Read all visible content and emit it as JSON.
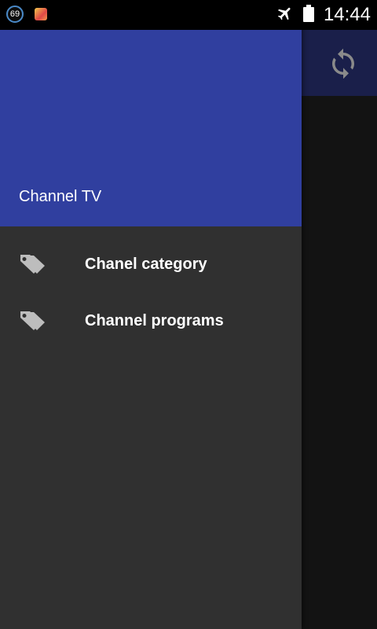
{
  "status_bar": {
    "notification_count": "69",
    "time": "14:44",
    "icons": [
      "notification-count-icon",
      "app-notification-icon",
      "airplane-mode-icon",
      "battery-icon"
    ]
  },
  "toolbar": {
    "action_icon": "refresh-icon"
  },
  "drawer": {
    "title": "Channel TV",
    "items": [
      {
        "label": "Chanel category",
        "icon": "tags-icon"
      },
      {
        "label": "Channel programs",
        "icon": "tags-icon"
      }
    ]
  },
  "colors": {
    "drawer_header": "#303f9f",
    "drawer_background": "#303030",
    "toolbar_behind_scrim": "#1a1f4a",
    "status_bar": "#000000",
    "icon_gray": "#bdbdbd"
  }
}
